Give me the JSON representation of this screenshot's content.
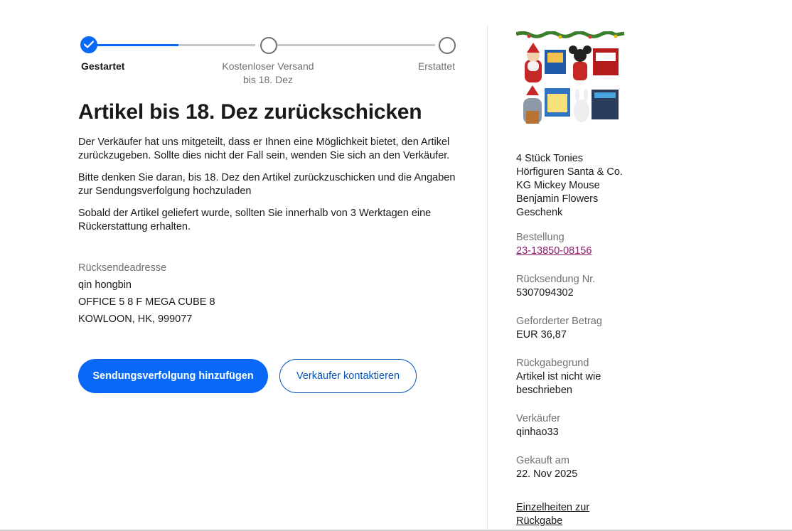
{
  "stepper": {
    "steps": [
      {
        "label": "Gestartet",
        "state": "done"
      },
      {
        "label": "Kostenloser Versand",
        "sublabel": "bis 18. Dez",
        "state": "pending"
      },
      {
        "label": "Erstattet",
        "state": "pending"
      }
    ],
    "progress": 0.5
  },
  "main": {
    "title": "Artikel bis 18. Dez zurückschicken",
    "paragraphs": [
      "Der Verkäufer hat uns mitgeteilt, dass er Ihnen eine Möglichkeit bietet, den Artikel zurückzugeben. Sollte dies nicht der Fall sein, wenden Sie sich an den Verkäufer.",
      "Bitte denken Sie daran, bis 18. Dez den Artikel zurückzuschicken und die Angaben zur Sendungsverfolgung hochzuladen",
      "Sobald der Artikel geliefert wurde, sollten Sie innerhalb von 3 Werktagen eine Rückerstattung erhalten."
    ],
    "address_label": "Rücksendeadresse",
    "address_lines": [
      "qin hongbin",
      "OFFICE 5 8 F MEGA CUBE 8",
      "KOWLOON, HK, 999077"
    ]
  },
  "actions": {
    "primary": "Sendungsverfolgung hinzufügen",
    "secondary": "Verkäufer kontaktieren"
  },
  "sidebar": {
    "item_title": "4 Stück Tonies Hörfiguren Santa & Co. KG Mickey Mouse Benjamin Flowers Geschenk",
    "details": [
      {
        "label": "Bestellung",
        "value": "23-13850-08156",
        "link": true
      },
      {
        "label": "Rücksendung Nr.",
        "value": "5307094302"
      },
      {
        "label": "Geforderter Betrag",
        "value": "EUR 36,87"
      },
      {
        "label": "Rückgabegrund",
        "value": "Artikel ist nicht wie beschrieben"
      },
      {
        "label": "Verkäufer",
        "value": "qinhao33"
      },
      {
        "label": "Gekauft am",
        "value": "22. Nov 2025"
      }
    ],
    "details_link": "Einzelheiten zur Rückgabe"
  },
  "colors": {
    "accent": "#0968f6",
    "link_purple": "#8a1a6c",
    "secondary_blue": "#0654ba",
    "muted_text": "#707070"
  }
}
